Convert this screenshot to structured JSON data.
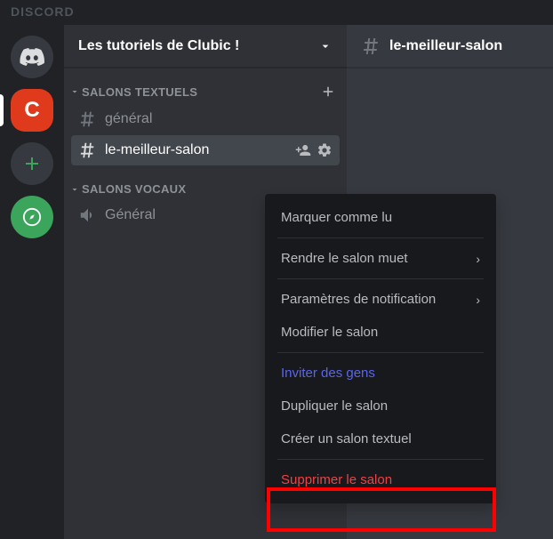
{
  "wordmark": "DISCORD",
  "server": {
    "name": "Les tutoriels de Clubic !"
  },
  "guild_active_initial": "C",
  "categories": {
    "text": {
      "label": "Salons textuels"
    },
    "voice": {
      "label": "Salons vocaux"
    }
  },
  "channels": {
    "general": "général",
    "selected": "le-meilleur-salon",
    "voice_general": "Général"
  },
  "header_channel": "le-meilleur-salon",
  "context_menu": {
    "mark_read": "Marquer comme lu",
    "mute": "Rendre le salon muet",
    "notif": "Paramètres de notification",
    "edit": "Modifier le salon",
    "invite": "Inviter des gens",
    "duplicate": "Dupliquer le salon",
    "create_text": "Créer un salon textuel",
    "delete": "Supprimer le salon"
  }
}
